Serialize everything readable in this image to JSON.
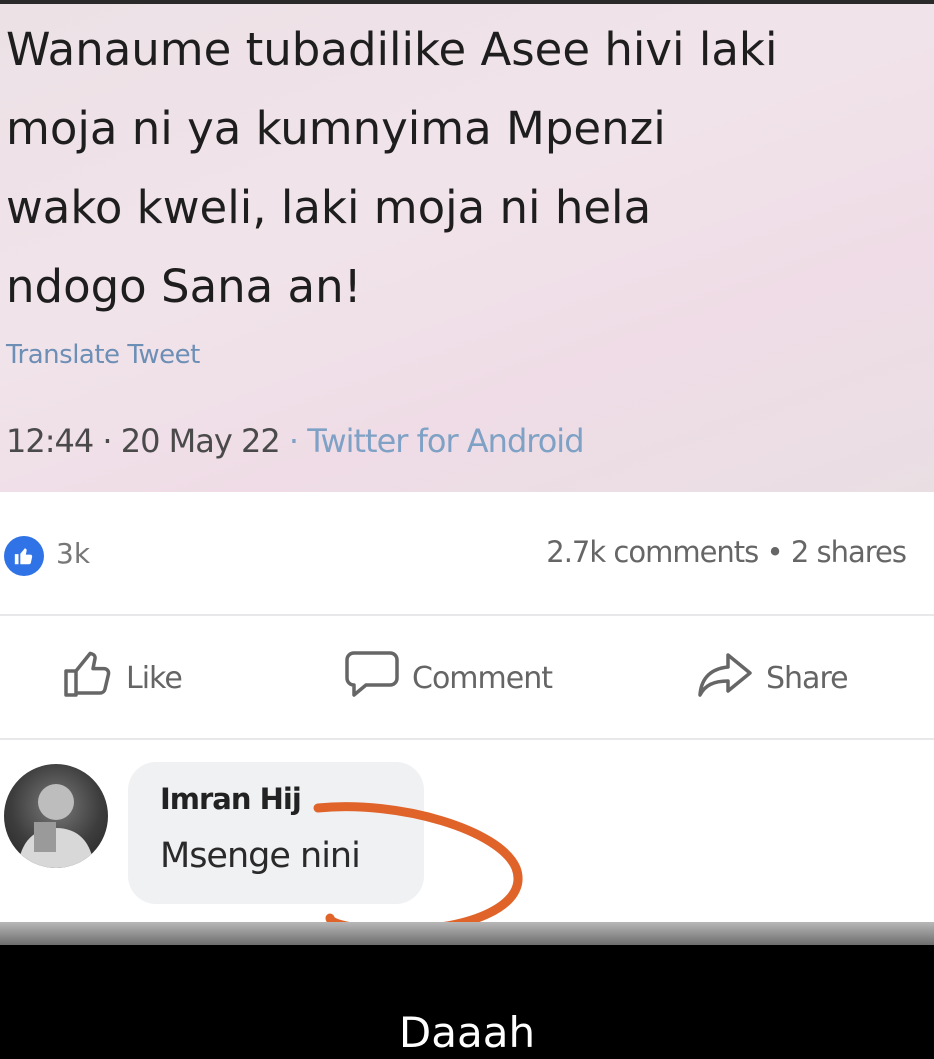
{
  "tweet": {
    "lines": [
      "Wanaume tubadilike Asee hivi laki",
      "moja ni ya kumnyima Mpenzi",
      "wako kweli, laki moja ni hela",
      "ndogo Sana an!"
    ],
    "translate_label": "Translate Tweet",
    "time": "12:44",
    "date": "20 May 22",
    "source": "Twitter for Android"
  },
  "reactions": {
    "like_count": "3k",
    "comments_count": "2.7k comments",
    "shares_count": "2 shares"
  },
  "actions": {
    "like": "Like",
    "comment": "Comment",
    "share": "Share"
  },
  "comment": {
    "author": "Imran Hij",
    "text": "Msenge nini"
  },
  "caption": "Daaah",
  "colors": {
    "facebook_blue": "#2f73e6",
    "annotation_orange": "#e0642a"
  }
}
